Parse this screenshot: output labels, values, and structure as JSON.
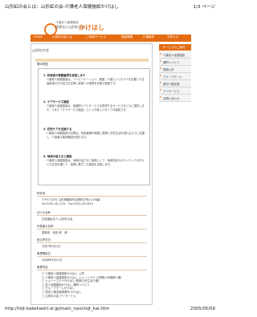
{
  "print_header": {
    "title": "山形虹の会とは：山形虹の会-介護老人保健施設かけはし",
    "page": "1/3 ページ"
  },
  "logo": {
    "sub": "介護老人保健施設",
    "name": "医療法人山形虹の会",
    "brand": "かけはし"
  },
  "nav": {
    "items": [
      "HOME",
      "山形虹の会とは",
      "ご利用サービス",
      "施設概要",
      "行事案内",
      "お知らせ"
    ]
  },
  "breadcrumb": "山形虹の会",
  "section_label": "基本理念",
  "policy": [
    {
      "heading": "1. 利用者の尊厳重視を目指します",
      "body": "介護老人保健施設は、リハビリテーション、看護・介護といったケアを必要とする高齢者の方の自立を支援し家庭への復帰を目指す施設です。"
    },
    {
      "heading": "2. ケアサービス施設",
      "body": "介護老人保健施設は、医療的ケアとサービスを提供するサービスをともに提供します。つまり「ケアサービス施設」といった新しいタイプの施設です。"
    },
    {
      "heading": "3. 在宅ケアを支援する",
      "body": "介護老人保健施設の目標は、利用者様が家庭に復帰し在宅生活を送れるように支援し、介護者の負担軽減を図ります。"
    },
    {
      "heading": "4. 地域の皆さまと施設",
      "body": "介護老人保健施設は、地域の皆さまと施設として、地域住民やボランティアの方々との交流を通じて、地域に根ざした施設を目指します。"
    }
  ],
  "info": [
    {
      "label": "所在地",
      "values": [
        "〒997-0261 山形県鶴岡市羽黒町字荒川159番1",
        "Tel:0235-26-1131　Fax:0235-26-0610"
      ]
    },
    {
      "label": "法人の名称",
      "values": [
        "社会福祉法人 山形虹の会"
      ]
    },
    {
      "label": "代表者の名称",
      "values": [
        "理事長　池田 修　博"
      ]
    },
    {
      "label": "設立許可日",
      "values": [
        "平成7年6月1日"
      ]
    },
    {
      "label": "事業開始日",
      "values": [
        "平成8年4月22日"
      ]
    },
    {
      "label": "事業内容",
      "values": [
        "□ 介護老人保健施設かけはし 入所",
        "□ 介護老人保健施設かけはし ショートステイ(短期入所療養介護)",
        "□ ショートステイかけはし(短期入所生活介護)",
        "□ 老人保健施設かけはし 通所リハビリ",
        "□ グループホームかけはし",
        "□ 居宅介護支援事業所 かけはし",
        "□ 山形虹の会 デイサービス"
      ]
    }
  ],
  "sidebar": {
    "header": "サービスのご案内",
    "items": [
      "介護老人保健施設",
      "通所リハビリ",
      "短期入所",
      "グループホーム",
      "居宅介護支援",
      "デイサービス",
      "お問い合わせ"
    ]
  },
  "print_footer": {
    "url": "http://nijt-kakehashi.or.jp/main_navi/nijt_kai.htm",
    "date": "2005/05/09"
  }
}
